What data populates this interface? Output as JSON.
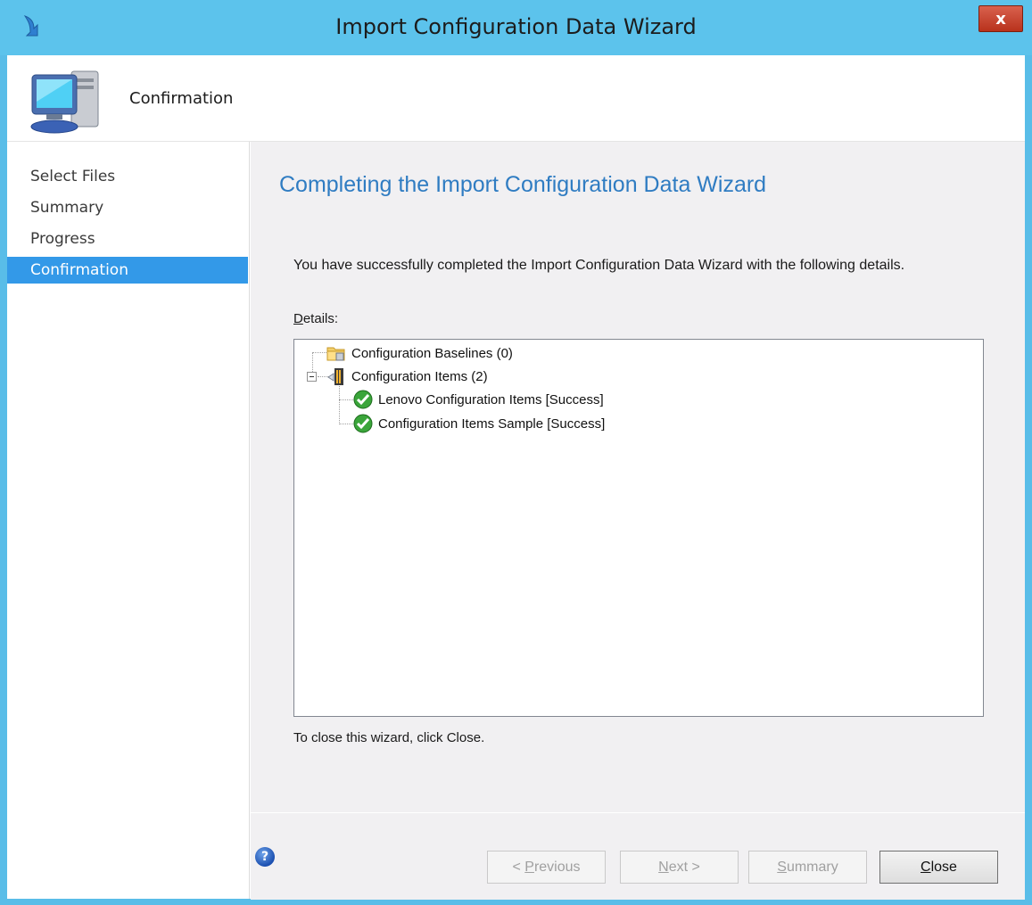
{
  "window": {
    "title": "Import Configuration Data Wizard",
    "close_glyph": "x",
    "accent_color": "#5cc3ec"
  },
  "header": {
    "title": "Confirmation",
    "icon": "computer-icon"
  },
  "sidebar": {
    "items": [
      {
        "label": "Select Files",
        "active": false
      },
      {
        "label": "Summary",
        "active": false
      },
      {
        "label": "Progress",
        "active": false
      },
      {
        "label": "Confirmation",
        "active": true
      }
    ],
    "active_color": "#3399e8"
  },
  "main": {
    "heading": "Completing the Import Configuration Data Wizard",
    "message": "You have successfully completed the Import Configuration Data Wizard with the following details.",
    "details_label": {
      "mnemonic": "D",
      "rest": "etails:"
    },
    "tree": [
      {
        "label": "Configuration Baselines (0)",
        "icon": "folder-icon",
        "level": 0
      },
      {
        "label": "Configuration Items (2)",
        "icon": "configuration-items-icon",
        "level": 0,
        "expanded": true
      },
      {
        "label": "Lenovo Configuration Items [Success]",
        "icon": "success-check-icon",
        "level": 1
      },
      {
        "label": "Configuration Items Sample [Success]",
        "icon": "success-check-icon",
        "level": 1
      }
    ],
    "close_hint": "To close this wizard, click Close."
  },
  "footer": {
    "help_glyph": "?",
    "previous": {
      "prefix": "< ",
      "mnemonic": "P",
      "rest": "revious",
      "enabled": false
    },
    "next": {
      "mnemonic": "N",
      "rest": "ext >",
      "enabled": false
    },
    "summary": {
      "mnemonic": "S",
      "rest": "ummary",
      "enabled": false
    },
    "close": {
      "mnemonic": "C",
      "rest": "lose",
      "enabled": true
    }
  }
}
